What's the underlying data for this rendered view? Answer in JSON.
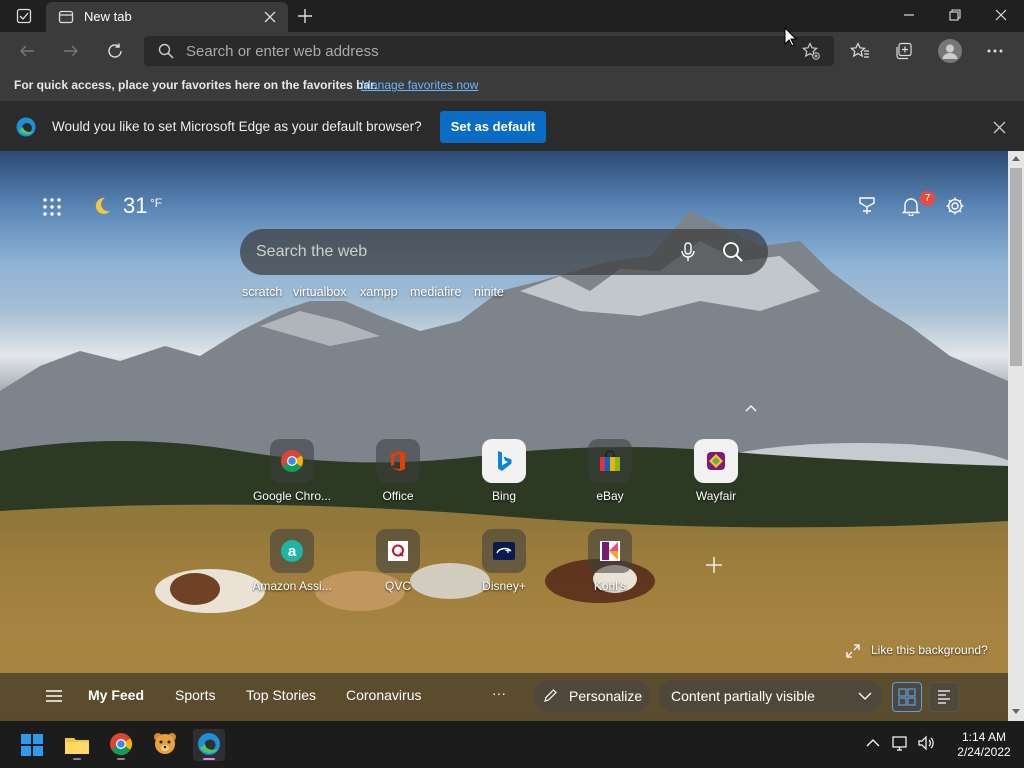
{
  "browser": {
    "tab_title": "New tab",
    "address_placeholder": "Search or enter web address"
  },
  "favorites_bar": {
    "message": "For quick access, place your favorites here on the favorites bar.",
    "link": "Manage favorites now"
  },
  "infobar": {
    "message": "Would you like to set Microsoft Edge as your default browser?",
    "button": "Set as default"
  },
  "ntp": {
    "weather_temp": "31",
    "weather_unit": "°F",
    "notification_count": "7",
    "search_placeholder": "Search the web",
    "quick_links": [
      "scratch",
      "virtualbox",
      "xampp",
      "mediafire",
      "ninite"
    ],
    "tiles_row1": [
      {
        "label": "Google Chro...",
        "icon": "chrome-icon"
      },
      {
        "label": "Office",
        "icon": "office-icon"
      },
      {
        "label": "Bing",
        "icon": "bing-icon"
      },
      {
        "label": "eBay",
        "icon": "ebay-icon"
      },
      {
        "label": "Wayfair",
        "icon": "wayfair-icon"
      }
    ],
    "tiles_row2": [
      {
        "label": "Amazon Assi...",
        "icon": "amazon-assistant-icon"
      },
      {
        "label": "QVC",
        "icon": "qvc-icon"
      },
      {
        "label": "Disney+",
        "icon": "disney-plus-icon"
      },
      {
        "label": "Kohl's",
        "icon": "kohls-icon"
      }
    ],
    "like_background": "Like this background?",
    "feed": {
      "items": [
        "My Feed",
        "Sports",
        "Top Stories",
        "Coronavirus"
      ],
      "more": "···",
      "personalize": "Personalize",
      "content_visibility": "Content partially visible"
    }
  },
  "taskbar": {
    "time": "1:14 AM",
    "date": "2/24/2022"
  },
  "colors": {
    "accent": "#0a6cc4",
    "link": "#6cb6ff",
    "badge": "#e74c3c"
  }
}
